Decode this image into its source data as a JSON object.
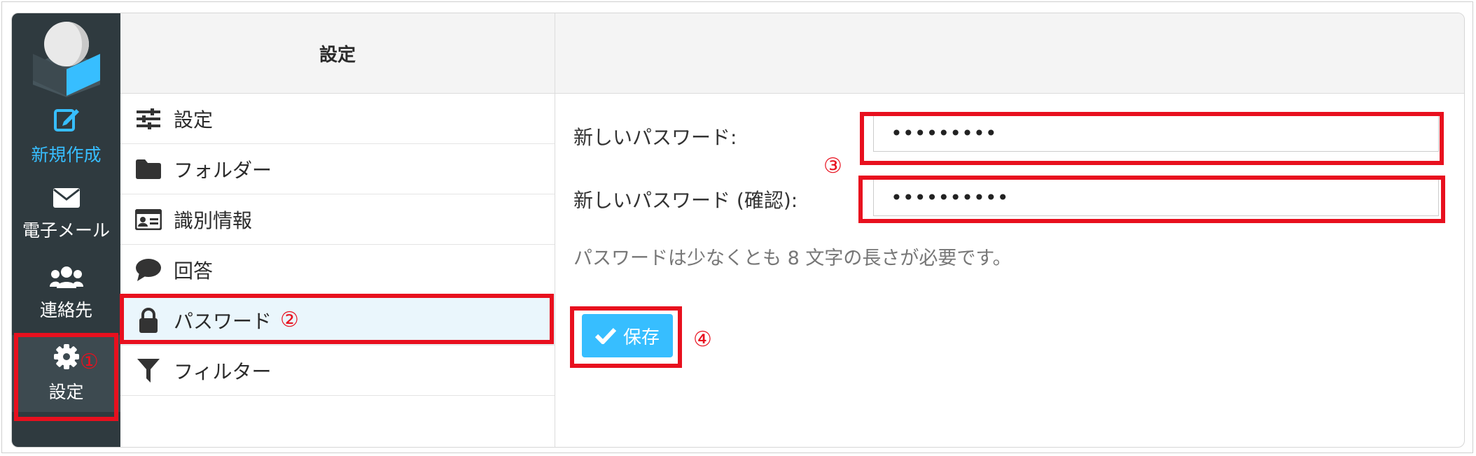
{
  "rail": {
    "items": [
      {
        "label": "新規作成",
        "icon": "compose-icon"
      },
      {
        "label": "電子メール",
        "icon": "envelope-icon"
      },
      {
        "label": "連絡先",
        "icon": "users-icon"
      },
      {
        "label": "設定",
        "icon": "gear-icon"
      }
    ]
  },
  "settings_list": {
    "title": "設定",
    "items": [
      {
        "label": "設定",
        "icon": "sliders-icon"
      },
      {
        "label": "フォルダー",
        "icon": "folder-icon"
      },
      {
        "label": "識別情報",
        "icon": "id-card-icon"
      },
      {
        "label": "回答",
        "icon": "speech-bubble-icon"
      },
      {
        "label": "パスワード",
        "icon": "lock-icon"
      },
      {
        "label": "フィルター",
        "icon": "filter-icon"
      }
    ],
    "selected": "パスワード"
  },
  "password_form": {
    "new_password_label": "新しいパスワード:",
    "new_password_value": "•••••••••",
    "confirm_password_label": "新しいパスワード (確認):",
    "confirm_password_value": "••••••••••",
    "hint": "パスワードは少なくとも 8 文字の長さが必要です。",
    "save_label": "保存"
  },
  "annotations": {
    "step1": "①",
    "step2": "②",
    "step3": "③",
    "step4": "④"
  },
  "colors": {
    "rail_bg": "#2f3a3f",
    "accent": "#37beff",
    "highlight": "#e8101e",
    "selected_bg": "#eaf6fc"
  }
}
